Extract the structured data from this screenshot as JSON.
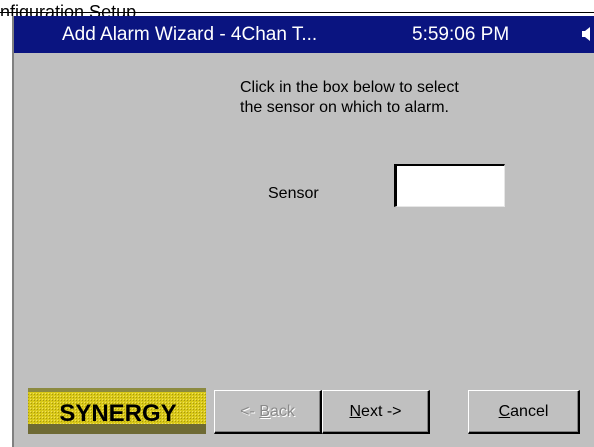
{
  "top_strip": {
    "partial_text": "nfiguration Setup"
  },
  "titlebar": {
    "title": "Add Alarm Wizard - 4Chan T...",
    "time": "5:59:06 PM"
  },
  "content": {
    "instructions_line1": "Click in the box below to select",
    "instructions_line2": "the sensor on which to alarm.",
    "sensor_label": "Sensor",
    "sensor_value": ""
  },
  "logo": {
    "text": "SYNERGY"
  },
  "buttons": {
    "back": {
      "prefix": "<- ",
      "mnemonic": "B",
      "rest": "ack",
      "enabled": false
    },
    "next": {
      "mnemonic": "N",
      "rest": "ext ->",
      "enabled": true
    },
    "cancel": {
      "mnemonic": "C",
      "rest": "ancel",
      "enabled": true
    }
  },
  "colors": {
    "titlebar": "#0a1480",
    "background": "#c0c0c0",
    "logo_yellow": "#d8c818",
    "disabled_text": "#8a8a8a"
  }
}
